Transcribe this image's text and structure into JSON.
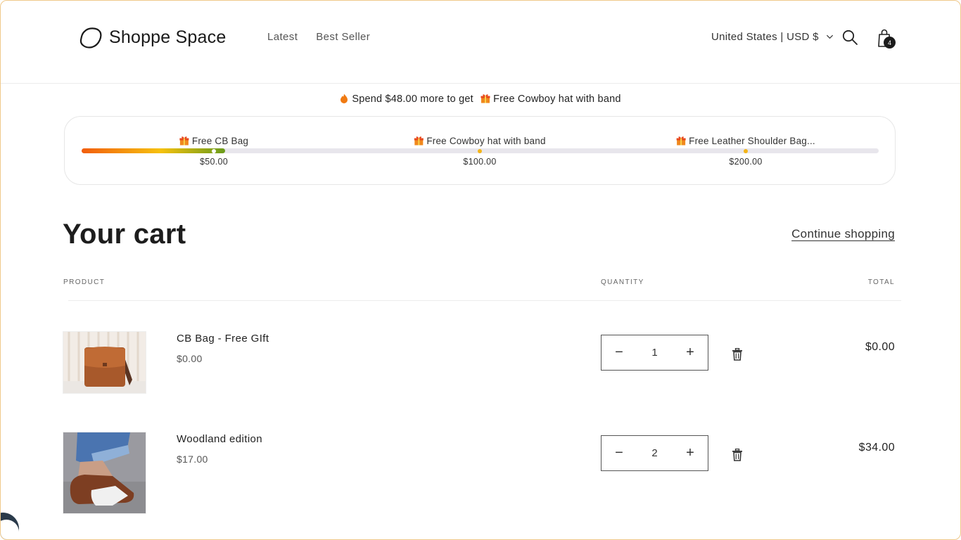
{
  "brand": {
    "name": "Shoppe Space"
  },
  "nav": {
    "items": [
      "Latest",
      "Best Seller"
    ]
  },
  "locale": {
    "label": "United States | USD $"
  },
  "cart_badge": {
    "count": "4"
  },
  "promo": {
    "message": "Spend $48.00 more to get",
    "reward": "Free Cowboy hat with band"
  },
  "progress": {
    "fill_fraction": 0.18,
    "milestones": [
      {
        "label": "Free CB Bag",
        "value": "$50.00",
        "reached": true
      },
      {
        "label": "Free Cowboy hat with band",
        "value": "$100.00",
        "reached": false
      },
      {
        "label": "Free Leather Shoulder Bag...",
        "value": "$200.00",
        "reached": false
      }
    ]
  },
  "cart": {
    "title": "Your cart",
    "continue_label": "Continue shopping",
    "columns": {
      "product": "PRODUCT",
      "quantity": "QUANTITY",
      "total": "TOTAL"
    },
    "items": [
      {
        "name": "CB Bag - Free GIft",
        "price": "$0.00",
        "quantity": "1",
        "total": "$0.00",
        "image": "brown-leather-bag"
      },
      {
        "name": "Woodland edition",
        "price": "$17.00",
        "quantity": "2",
        "total": "$34.00",
        "image": "no-show-socks"
      }
    ],
    "decrease_symbol": "−",
    "increase_symbol": "+"
  },
  "colors": {
    "accent": "#f3b417",
    "progress_start": "#f25d0c",
    "progress_end": "#6a9b1b",
    "text": "#232323"
  }
}
